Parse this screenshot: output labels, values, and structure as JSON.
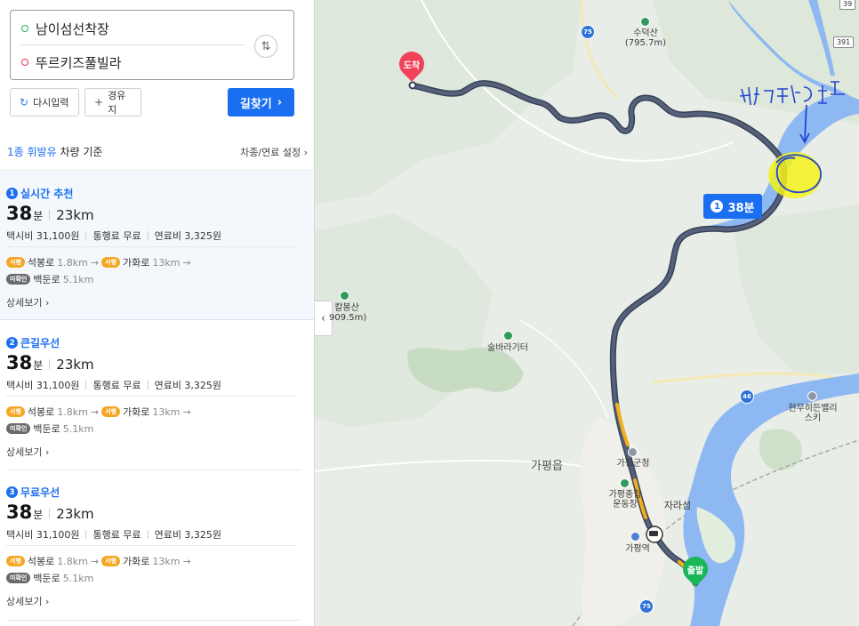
{
  "search": {
    "origin": "남이섬선착장",
    "destination": "뚜르키즈풀빌라",
    "swap_icon": "swap-arrows-icon"
  },
  "actions": {
    "reset_label": "다시입력",
    "waypoint_label": "경유지",
    "search_label": "길찾기"
  },
  "basis": {
    "highlight": "1종 휘발유",
    "rest": "차량 기준",
    "settings_label": "차종/연료 설정"
  },
  "results": [
    {
      "num": "1",
      "title": "실시간 추천",
      "minutes": "38",
      "unit": "분",
      "distance": "23km",
      "taxi": "택시비 31,100원",
      "toll": "통행료 무료",
      "fuel": "연료비 3,325원",
      "road1_tag": "서행",
      "road1": "석봉로",
      "road1_dist": "1.8km",
      "road2_tag": "서행",
      "road2": "가화로",
      "road2_dist": "13km",
      "road3_tag": "미확인",
      "road3": "백둔로",
      "road3_dist": "5.1km",
      "detail": "상세보기"
    },
    {
      "num": "2",
      "title": "큰길우선",
      "minutes": "38",
      "unit": "분",
      "distance": "23km",
      "taxi": "택시비 31,100원",
      "toll": "통행료 무료",
      "fuel": "연료비 3,325원",
      "road1_tag": "서행",
      "road1": "석봉로",
      "road1_dist": "1.8km",
      "road2_tag": "서행",
      "road2": "가화로",
      "road2_dist": "13km",
      "road3_tag": "미확인",
      "road3": "백둔로",
      "road3_dist": "5.1km",
      "detail": "상세보기"
    },
    {
      "num": "3",
      "title": "무료우선",
      "minutes": "38",
      "unit": "분",
      "distance": "23km",
      "taxi": "택시비 31,100원",
      "toll": "통행료 무료",
      "fuel": "연료비 3,325원",
      "road1_tag": "서행",
      "road1": "석봉로",
      "road1_dist": "1.8km",
      "road2_tag": "서행",
      "road2": "가화로",
      "road2_dist": "13km",
      "road3_tag": "미확인",
      "road3": "백둔로",
      "road3_dist": "5.1km",
      "detail": "상세보기"
    }
  ],
  "map": {
    "bubble_num": "1",
    "bubble_text": "38분",
    "end_pin": "도착",
    "start_pin": "출발",
    "labels": {
      "suduksan": "수덕산",
      "suduksan_h": "(795.7m)",
      "kalbongsan": "칼봉산",
      "kalbongsan_h": "909.5m)",
      "sulbara": "술바라기터",
      "gapyeong_eup": "가평읍",
      "gapyeong_office": "가평군청",
      "stadium1": "가평종합",
      "stadium2": "운동장",
      "jaraseom": "자라섬",
      "gapyeong_station": "가평역",
      "elysian1": "현무히든밸리",
      "elysian2": "스키"
    },
    "shields": [
      "75",
      "46",
      "75"
    ],
    "squares": [
      "391",
      "39"
    ],
    "annotation_text": "남바르드",
    "colors": {
      "route": "#4a5468",
      "route_slow": "#f2b01e",
      "water": "#8db8f2",
      "land": "#e9ede8",
      "forest": "#d5e5d3",
      "highlight": "#f5f21a",
      "pen": "#2444d0"
    }
  },
  "ui": {
    "collapse_icon": "chevron-left-icon",
    "reset_icon": "refresh-icon",
    "waypoint_icon": "plus-icon"
  }
}
